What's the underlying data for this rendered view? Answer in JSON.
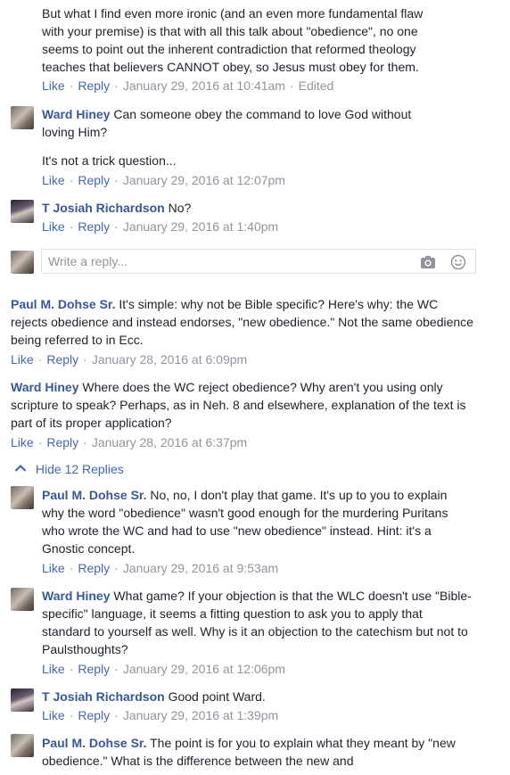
{
  "labels": {
    "like": "Like",
    "reply": "Reply",
    "edited": "Edited"
  },
  "top_comment": {
    "lines": [
      "But what I find even more ironic (and an even more fundamental flaw",
      "with your premise) is that with all this talk about \"obedience\", no one",
      "seems to point out the inherent contradiction that reformed theology",
      "teaches that believers CANNOT obey, so Jesus must obey for them."
    ],
    "time": "January 29, 2016 at 10:41am"
  },
  "replies_a": [
    {
      "author": "Ward Hiney",
      "text": "Can someone obey the command to love God without loving Him?",
      "text2": "It's not a trick question...",
      "time": "January 29, 2016 at 12:07pm"
    },
    {
      "author": "T Josiah Richardson",
      "text": "No?",
      "time": "January 29, 2016 at 1:40pm"
    }
  ],
  "reply_input": {
    "placeholder": "Write a reply..."
  },
  "comments": [
    {
      "author": "Paul M. Dohse Sr.",
      "text": "It's simple: why not be Bible specific? Here's why: the WC rejects obedience and instead endorses, \"new obedience.\" Not the same obedience being referred to in Ecc.",
      "time": "January 28, 2016 at 6:09pm"
    },
    {
      "author": "Ward Hiney",
      "text": "Where does the WC reject obedience? Why aren't you using only scripture to speak? Perhaps, as in Neh. 8 and elsewhere, explanation of the text is part of its proper application?",
      "time": "January 28, 2016 at 6:37pm"
    }
  ],
  "hide_replies": "Hide 12 Replies",
  "replies_b": [
    {
      "author": "Paul M. Dohse Sr.",
      "text": "No, no, I don't play that game. It's up to you to explain why the word \"obedience\" wasn't good enough for the murdering Puritans who wrote the WC and had to use \"new obedience\" instead. Hint: it's a Gnostic concept.",
      "time": "January 29, 2016 at 9:53am"
    },
    {
      "author": "Ward Hiney",
      "text": "What game? If your objection is that the WLC doesn't use \"Bible-specific\" language, it seems a fitting question to ask you to apply that standard to yourself as well. Why is it an objection to the catechism but not to Paulsthoughts?",
      "time": "January 29, 2016 at 12:06pm"
    },
    {
      "author": "T Josiah Richardson",
      "text": "Good point Ward.",
      "time": "January 29, 2016 at 1:39pm"
    },
    {
      "author": "Paul M. Dohse Sr.",
      "text": "The point is for you to explain what they meant by \"new obedience.\" What is the difference between the new and"
    }
  ]
}
